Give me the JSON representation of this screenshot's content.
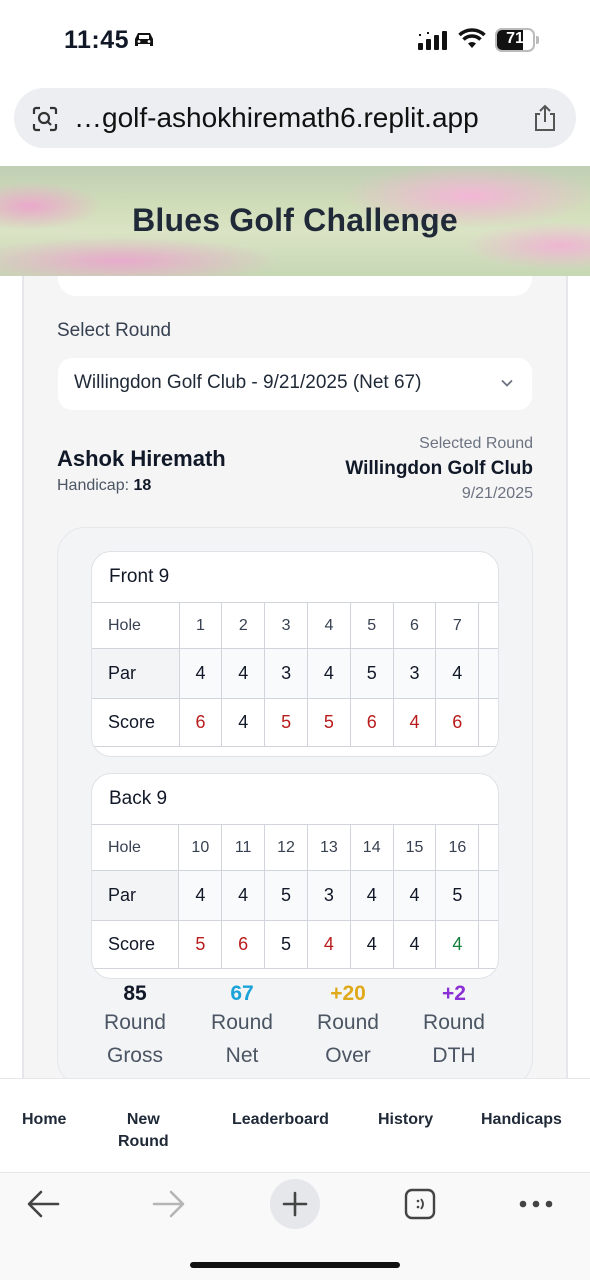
{
  "status_bar": {
    "time": "11:45",
    "battery": "71",
    "battery_fraction": 0.71,
    "icons": [
      "car-icon",
      "signal-icon",
      "wifi-icon",
      "battery-icon"
    ]
  },
  "browser": {
    "url": "…golf-ashokhiremath6.replit.app"
  },
  "header": {
    "title": "Blues Golf Challenge"
  },
  "round_selector": {
    "label": "Select Round",
    "selected": "Willingdon Golf Club - 9/21/2025 (Net 67)"
  },
  "player": {
    "name": "Ashok Hiremath",
    "handicap_label": "Handicap:",
    "handicap_value": "18"
  },
  "selected_round": {
    "label": "Selected Round",
    "course": "Willingdon Golf Club",
    "date": "9/21/2025"
  },
  "front_nine": {
    "title": "Front 9",
    "row_labels": {
      "hole": "Hole",
      "par": "Par",
      "score": "Score"
    },
    "holes": [
      "1",
      "2",
      "3",
      "4",
      "5",
      "6",
      "7"
    ],
    "par": [
      "4",
      "4",
      "3",
      "4",
      "5",
      "3",
      "4"
    ],
    "score": [
      "6",
      "4",
      "5",
      "5",
      "6",
      "4",
      "6"
    ]
  },
  "back_nine": {
    "title": "Back 9",
    "row_labels": {
      "hole": "Hole",
      "par": "Par",
      "score": "Score"
    },
    "holes": [
      "10",
      "11",
      "12",
      "13",
      "14",
      "15",
      "16"
    ],
    "par": [
      "4",
      "4",
      "5",
      "3",
      "4",
      "4",
      "5"
    ],
    "score": [
      "5",
      "6",
      "5",
      "4",
      "4",
      "4",
      "4"
    ]
  },
  "summary": [
    {
      "value": "85",
      "label_1": "Round",
      "label_2": "Gross",
      "color": "#111827"
    },
    {
      "value": "67",
      "label_1": "Round",
      "label_2": "Net",
      "color": "#1aa3d9"
    },
    {
      "value": "+20",
      "label_1": "Round",
      "label_2": "Over",
      "color": "#e0a91a"
    },
    {
      "value": "+2",
      "label_1": "Round",
      "label_2": "DTH",
      "color": "#8b2fd6"
    }
  ],
  "colors": {
    "over_par": "#b91c1c",
    "under_par": "#15803d"
  },
  "bottom_nav": {
    "home": "Home",
    "new_round_1": "New",
    "new_round_2": "Round",
    "leaderboard": "Leaderboard",
    "history": "History",
    "handicaps": "Handicaps"
  },
  "browser_toolbar": {
    "icons": [
      "back-arrow-icon",
      "forward-arrow-icon",
      "plus-icon",
      "tabs-icon",
      "more-icon"
    ]
  }
}
